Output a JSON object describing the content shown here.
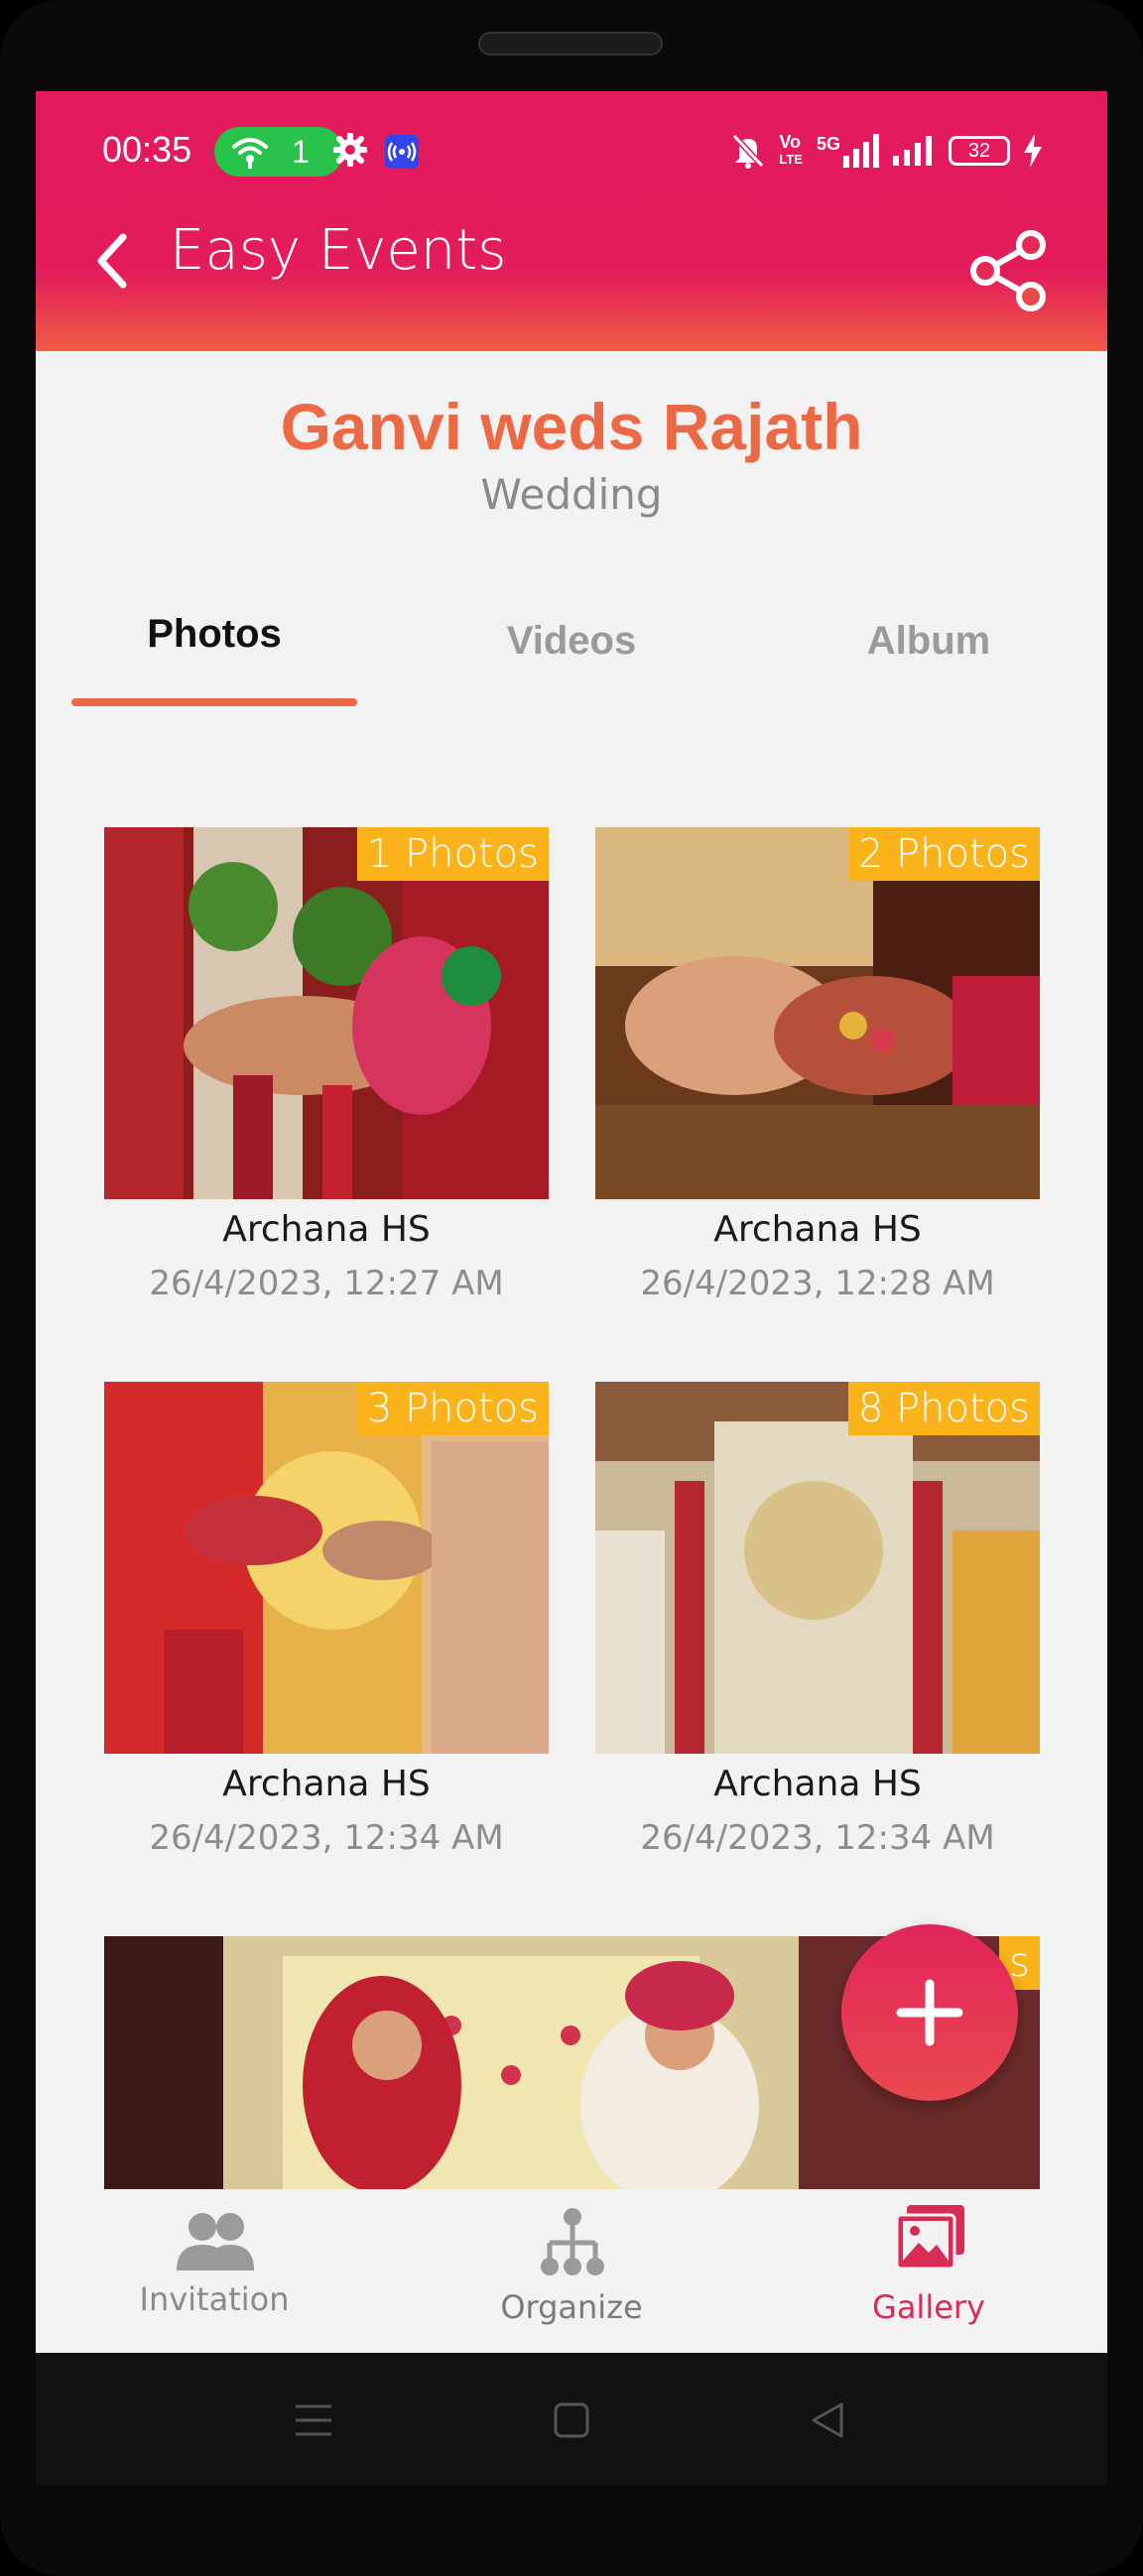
{
  "status_bar": {
    "time": "00:35",
    "hotspot_count": "1",
    "vo_top": "Vo",
    "vo_bottom": "LTE",
    "net_5g": "5G",
    "battery": "32"
  },
  "app_bar": {
    "title": "Easy Events",
    "back_icon": "chevron-left-icon",
    "share_icon": "share-icon"
  },
  "event": {
    "title": "Ganvi weds Rajath",
    "type": "Wedding"
  },
  "tabs": [
    {
      "label": "Photos",
      "active": true
    },
    {
      "label": "Videos",
      "active": false
    },
    {
      "label": "Album",
      "active": false
    }
  ],
  "gallery": [
    {
      "badge": "1 Photos",
      "author": "Archana HS",
      "date": "26/4/2023, 12:27 AM"
    },
    {
      "badge": "2 Photos",
      "author": "Archana HS",
      "date": "26/4/2023, 12:28 AM"
    },
    {
      "badge": "3 Photos",
      "author": "Archana HS",
      "date": "26/4/2023, 12:34 AM"
    },
    {
      "badge": "8 Photos",
      "author": "Archana HS",
      "date": "26/4/2023, 12:34 AM"
    },
    {
      "badge": "s"
    }
  ],
  "fab": {
    "icon": "plus-icon"
  },
  "bottom_nav": [
    {
      "label": "Invitation",
      "icon": "people-icon",
      "active": false
    },
    {
      "label": "Organize",
      "icon": "hierarchy-icon",
      "active": false
    },
    {
      "label": "Gallery",
      "icon": "gallery-icon",
      "active": true
    }
  ],
  "colors": {
    "brand": "#e31a5c",
    "accent": "#eb6a45",
    "badge": "#fbb31b"
  }
}
